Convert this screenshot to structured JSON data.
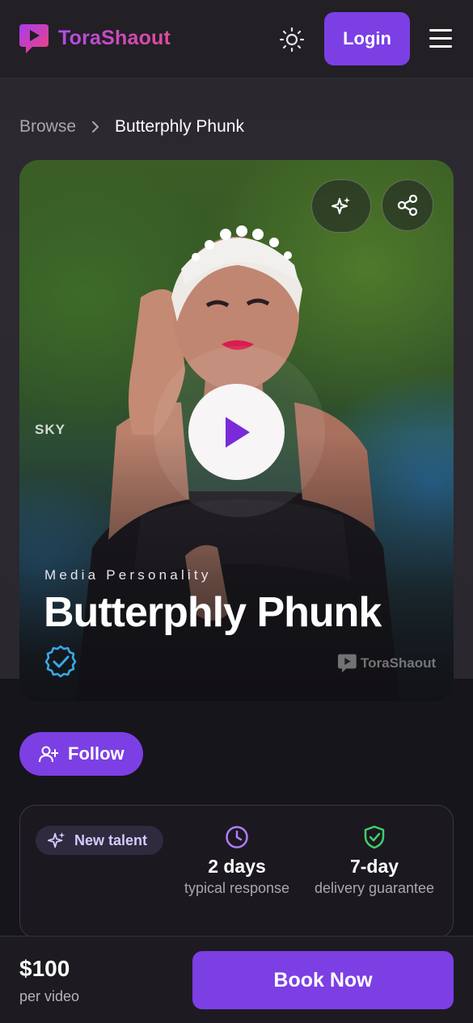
{
  "app": {
    "brand": "ToraShaout"
  },
  "header": {
    "login_label": "Login"
  },
  "breadcrumb": {
    "root": "Browse",
    "current": "Butterphly Phunk"
  },
  "hero": {
    "category": "Media Personality",
    "name": "Butterphly Phunk",
    "photo_watermark": "SKY",
    "brand_watermark": "ToraShaout",
    "verified": true
  },
  "actions": {
    "follow_label": "Follow"
  },
  "stats": {
    "badge": "New talent",
    "response": {
      "value": "2 days",
      "label": "typical response"
    },
    "delivery": {
      "value": "7-day",
      "label": "delivery guarantee"
    }
  },
  "booking": {
    "price": "$100",
    "unit": "per video",
    "cta": "Book Now"
  },
  "colors": {
    "accent": "#7c3fe4",
    "verified": "#3aa8e8",
    "shield": "#3fcf6a",
    "clock": "#b07cff"
  },
  "icons": [
    "logo-icon",
    "sun-icon",
    "menu-icon",
    "chevron-right-icon",
    "sparkle-icon",
    "share-icon",
    "play-icon",
    "verified-icon",
    "user-plus-icon",
    "clock-icon",
    "shield-check-icon"
  ]
}
